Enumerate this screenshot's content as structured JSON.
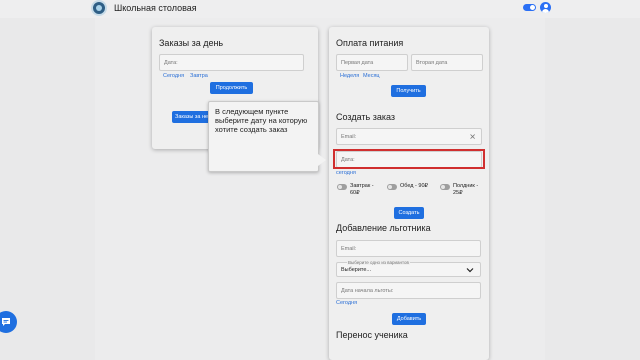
{
  "header": {
    "app_title": "Школьная столовая"
  },
  "orders_card": {
    "title": "Заказы за день",
    "date_placeholder": "Дата:",
    "today_link": "Сегодня",
    "tomorrow_link": "Завтра",
    "continue_button": "Продолжить",
    "orders_button": "Заказы за неделю"
  },
  "payment_card": {
    "title": "Оплата питания",
    "first_date_placeholder": "Первая дата",
    "second_date_placeholder": "Вторая дата",
    "week_link": "Неделя",
    "month_link": "Месяц",
    "get_button": "Получить"
  },
  "create_order": {
    "title": "Создать заказ",
    "email_placeholder": "Email:",
    "date_placeholder": "Дата:",
    "today_link": "сегодня",
    "meals": [
      {
        "label": "Завтрак -\n60₽",
        "enabled": false
      },
      {
        "label": "Обед - 90₽",
        "enabled": false
      },
      {
        "label": "Полдник -\n25₽",
        "enabled": false
      }
    ],
    "create_button": "Создать"
  },
  "beneficiary": {
    "title": "Добавление льготника",
    "email_placeholder": "Email:",
    "select_floating_label": "Выберите одно из вариантов",
    "select_value": "Выберите...",
    "start_date_placeholder": "Дата начала льготы:",
    "today_link": "Сегодня",
    "add_button": "Добавить"
  },
  "transfer": {
    "title": "Перенос ученика"
  },
  "tooltip": {
    "text": "В следующем пункте выберите дату на которую хотите создать заказ"
  },
  "colors": {
    "accent": "#1f6fe0",
    "highlight": "#d02f2f"
  }
}
